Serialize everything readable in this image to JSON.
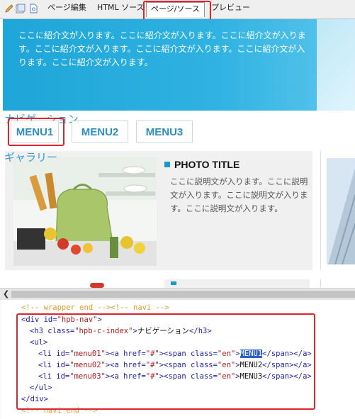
{
  "toolbar": {
    "tabs": [
      "ページ編集",
      "HTML ソース",
      "ページ/ソース",
      "プレビュー"
    ]
  },
  "hero": {
    "text": "ここに紹介文が入ります。ここに紹介文が入ります。ここに紹介文が入ります。ここに紹介文が入ります。ここに紹介文が入ります。ここに紹介文が入ります。ここに紹介文が入ります。"
  },
  "nav": {
    "heading": "ナビゲーション",
    "menus": [
      "MENU1",
      "MENU2",
      "MENU3"
    ]
  },
  "gallery": {
    "heading": "ギャラリー",
    "photo_title": "PHOTO TITLE",
    "description": "ここに説明文が入ります。ここに説明文が入ります。ここに説明文が入ります。ここに説明文が入ります。"
  },
  "code": {
    "comment_top": "<!-- wrapper end --><!-- navi -->",
    "div_open_tag": "<div ",
    "id_attr": "id=",
    "nav_id": "\"hpb-nav\"",
    "gt": ">",
    "h3_open": "<h3 ",
    "class_attr": "class=",
    "h3_class": "\"hpb-c-index\"",
    "h3_text": "ナビゲーション",
    "h3_close": "</h3>",
    "ul_open": "<ul>",
    "li_open": "<li ",
    "menu01_id": "\"menu01\"",
    "menu02_id": "\"menu02\"",
    "menu03_id": "\"menu03\"",
    "a_open": "<a ",
    "href_attr": "href=",
    "href_val": "\"#\"",
    "span_open": "<span ",
    "span_class": "\"en\"",
    "selected_text": "MENU1",
    "menu2_text": "MENU2",
    "menu3_text": "MENU3",
    "span_close": "</span>",
    "a_close": "</a>",
    "ul_close": "</ul>",
    "div_close": "</div>",
    "comment_bottom": "<!-- navi end -->"
  }
}
